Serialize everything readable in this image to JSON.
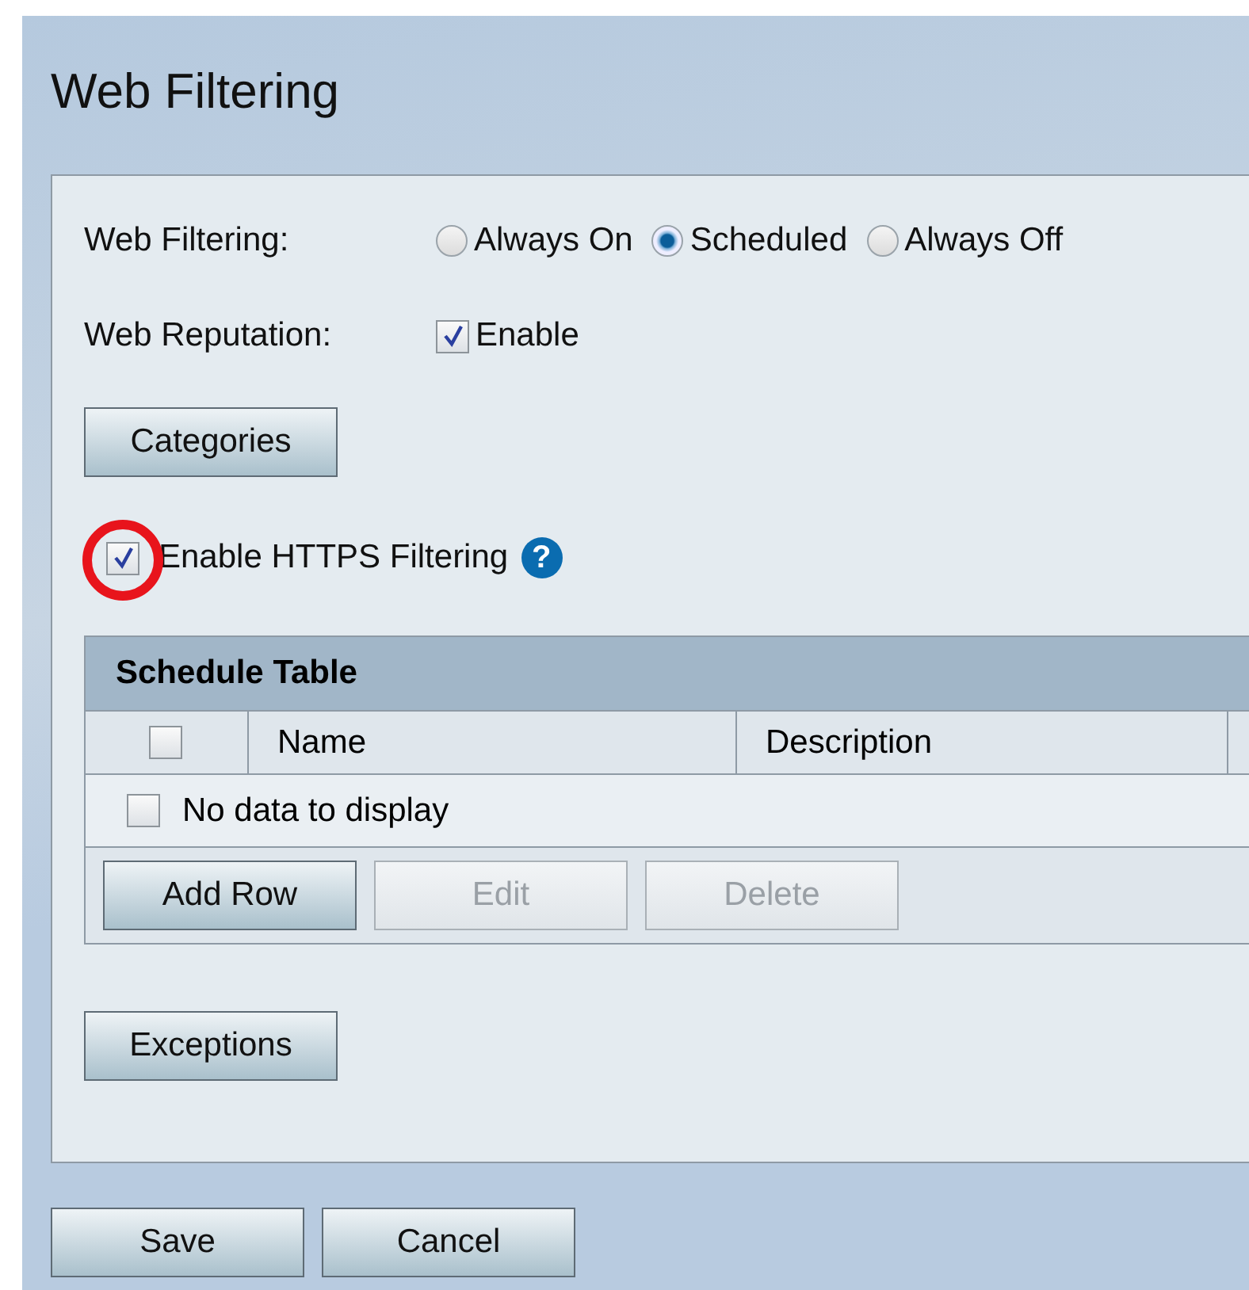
{
  "title": "Web Filtering",
  "web_filtering": {
    "label": "Web Filtering:",
    "options": [
      {
        "label": "Always On",
        "selected": false
      },
      {
        "label": "Scheduled",
        "selected": true
      },
      {
        "label": "Always Off",
        "selected": false
      }
    ]
  },
  "web_reputation": {
    "label": "Web Reputation:",
    "checkbox_label": "Enable",
    "checked": true
  },
  "categories_button": "Categories",
  "https_filtering": {
    "label": "Enable HTTPS Filtering",
    "checked": true,
    "highlighted": true,
    "help": "?"
  },
  "schedule_table": {
    "title": "Schedule Table",
    "select_all_checked": false,
    "columns": [
      "Name",
      "Description"
    ],
    "empty_text": "No data to display",
    "empty_checked": false,
    "buttons": [
      {
        "label": "Add Row",
        "disabled": false
      },
      {
        "label": "Edit",
        "disabled": true
      },
      {
        "label": "Delete",
        "disabled": true
      }
    ]
  },
  "exceptions_button": "Exceptions",
  "footer_buttons": [
    "Save",
    "Cancel"
  ]
}
